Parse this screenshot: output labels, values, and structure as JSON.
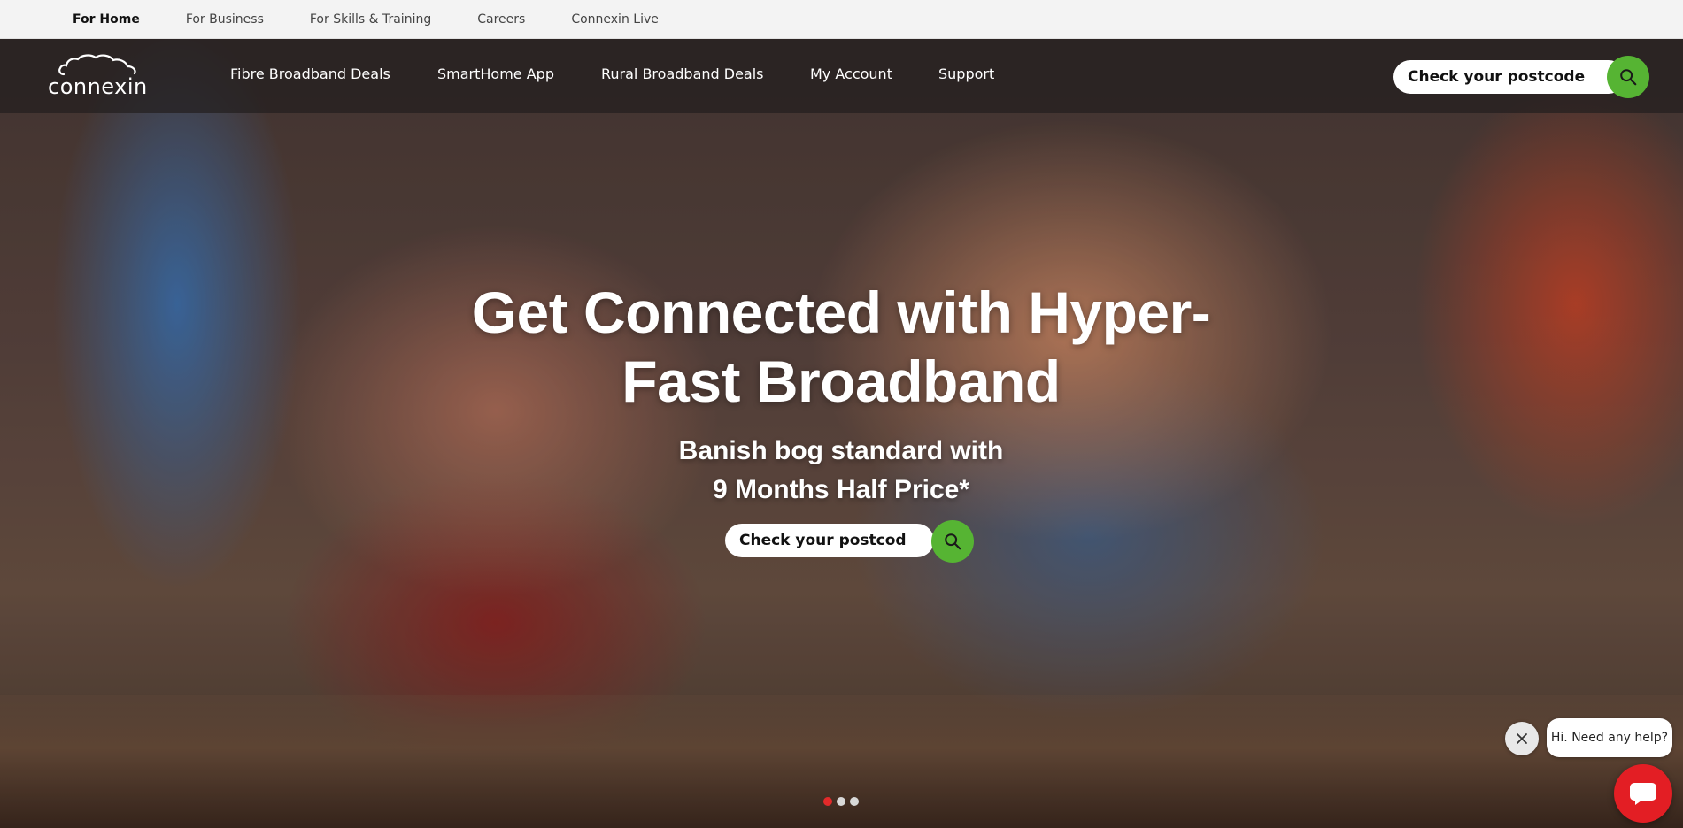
{
  "utility_nav": [
    {
      "label": "For Home",
      "active": true
    },
    {
      "label": "For Business",
      "active": false
    },
    {
      "label": "For Skills & Training",
      "active": false
    },
    {
      "label": "Careers",
      "active": false
    },
    {
      "label": "Connexin Live",
      "active": false
    }
  ],
  "brand": {
    "logo_text": "connexin"
  },
  "main_nav": [
    {
      "label": "Fibre Broadband Deals"
    },
    {
      "label": "SmartHome App"
    },
    {
      "label": "Rural Broadband Deals"
    },
    {
      "label": "My Account"
    },
    {
      "label": "Support"
    }
  ],
  "header_search": {
    "placeholder": "Check your postcode",
    "icon": "search-icon"
  },
  "hero": {
    "headline_line1": "Get Connected with Hyper-",
    "headline_line2": "Fast Broadband",
    "sub_line1": "Banish bog standard with",
    "sub_line2": "9 Months Half Price*",
    "search_placeholder": "Check your postcode"
  },
  "carousel": {
    "slides": 3,
    "active_index": 0
  },
  "chat": {
    "greeting": "Hi. Need any help?",
    "close_icon": "close-icon",
    "launcher_icon": "chat-icon"
  },
  "colors": {
    "accent_green": "#56b433",
    "chat_red": "#e31e24",
    "dot_active": "#e22a2a"
  }
}
